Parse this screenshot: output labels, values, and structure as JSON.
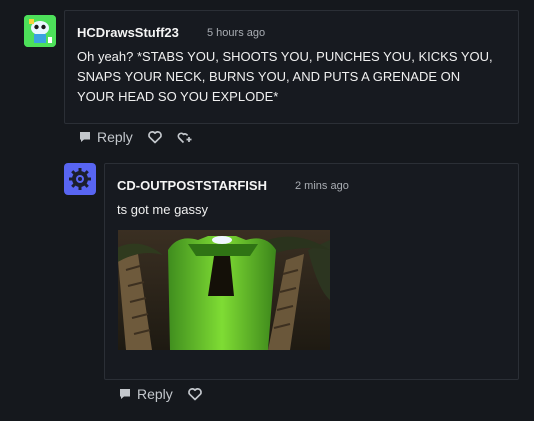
{
  "comments": [
    {
      "username": "HCDrawsStuff23",
      "timestamp": "5 hours ago",
      "body_lines": [
        "Oh yeah? *STABS YOU, SHOOTS YOU, PUNCHES YOU, KICKS YOU,",
        "SNAPS YOUR NECK, BURNS YOU, AND PUTS A GRENADE ON",
        "YOUR HEAD SO YOU EXPLODE*"
      ],
      "reply_label": "Reply"
    },
    {
      "username": "CD-OUTPOSTSTARFISH",
      "timestamp": "2 mins ago",
      "body": "ts got me gassy",
      "reply_label": "Reply"
    }
  ],
  "colors": {
    "background": "#15181d",
    "card_border": "#2b2f36",
    "avatar1": "#4de05a",
    "avatar2": "#5865f2"
  },
  "icons": [
    "reply-icon",
    "heart-icon",
    "add-reaction-icon",
    "gif-image"
  ]
}
